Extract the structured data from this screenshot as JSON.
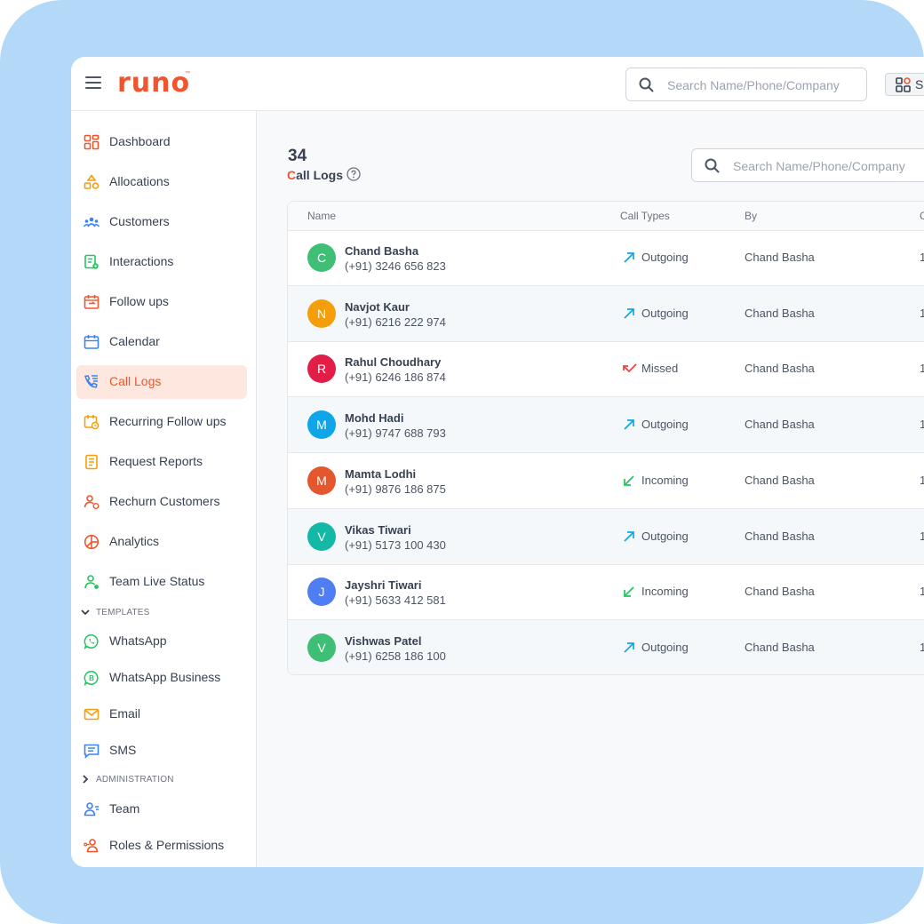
{
  "app": {
    "logo": "runo",
    "logo_tm": "™"
  },
  "header": {
    "search_placeholder": "Search Name/Phone/Company",
    "switch_label": "S"
  },
  "sidebar": {
    "items": [
      {
        "label": "Dashboard",
        "icon": "dashboard-icon"
      },
      {
        "label": "Allocations",
        "icon": "allocations-icon"
      },
      {
        "label": "Customers",
        "icon": "customers-icon"
      },
      {
        "label": "Interactions",
        "icon": "interactions-icon"
      },
      {
        "label": "Follow ups",
        "icon": "follow-ups-icon"
      },
      {
        "label": "Calendar",
        "icon": "calendar-icon"
      },
      {
        "label": "Call Logs",
        "icon": "call-logs-icon",
        "active": true
      },
      {
        "label": "Recurring Follow ups",
        "icon": "recurring-icon"
      },
      {
        "label": "Request Reports",
        "icon": "reports-icon"
      },
      {
        "label": "Rechurn Customers",
        "icon": "rechurn-icon"
      },
      {
        "label": "Analytics",
        "icon": "analytics-icon"
      },
      {
        "label": "Team Live Status",
        "icon": "team-status-icon"
      }
    ],
    "templates_label": "TEMPLATES",
    "templates": [
      {
        "label": "WhatsApp",
        "icon": "whatsapp-icon"
      },
      {
        "label": "WhatsApp Business",
        "icon": "whatsapp-business-icon"
      },
      {
        "label": "Email",
        "icon": "email-icon"
      },
      {
        "label": "SMS",
        "icon": "sms-icon"
      }
    ],
    "administration_label": "ADMINISTRATION",
    "administration": [
      {
        "label": "Team",
        "icon": "team-icon"
      },
      {
        "label": "Roles & Permissions",
        "icon": "roles-icon"
      }
    ]
  },
  "main": {
    "count": "34",
    "title_first": "C",
    "title_rest": "all Logs",
    "search_placeholder": "Search Name/Phone/Company",
    "columns": [
      "Name",
      "Call Types",
      "By",
      "C"
    ],
    "rows": [
      {
        "initial": "C",
        "name": "Chand Basha",
        "phone": "(+91) 3246 656 823",
        "type": "Outgoing",
        "by": "Chand Basha",
        "extra": "1",
        "avatar_color": "#3fbf75"
      },
      {
        "initial": "N",
        "name": "Navjot Kaur",
        "phone": "(+91) 6216 222 974",
        "type": "Outgoing",
        "by": "Chand Basha",
        "extra": "1",
        "avatar_color": "#f59e0b"
      },
      {
        "initial": "R",
        "name": "Rahul Choudhary",
        "phone": "(+91) 6246 186 874",
        "type": "Missed",
        "by": "Chand Basha",
        "extra": "1",
        "avatar_color": "#e11d48"
      },
      {
        "initial": "M",
        "name": "Mohd Hadi",
        "phone": "(+91) 9747 688 793",
        "type": "Outgoing",
        "by": "Chand Basha",
        "extra": "1",
        "avatar_color": "#0ea5e9"
      },
      {
        "initial": "M",
        "name": "Mamta Lodhi",
        "phone": "(+91) 9876 186 875",
        "type": "Incoming",
        "by": "Chand Basha",
        "extra": "1",
        "avatar_color": "#e4572e"
      },
      {
        "initial": "V",
        "name": "Vikas Tiwari",
        "phone": "(+91) 5173 100 430",
        "type": "Outgoing",
        "by": "Chand Basha",
        "extra": "1",
        "avatar_color": "#14b8a6"
      },
      {
        "initial": "J",
        "name": "Jayshri Tiwari",
        "phone": "(+91) 5633 412 581",
        "type": "Incoming",
        "by": "Chand Basha",
        "extra": "1",
        "avatar_color": "#4f7ef2"
      },
      {
        "initial": "V",
        "name": "Vishwas Patel",
        "phone": "(+91) 6258 186 100",
        "type": "Outgoing",
        "by": "Chand Basha",
        "extra": "1",
        "avatar_color": "#3fbf75"
      }
    ]
  },
  "colors": {
    "brand": "#f0552e",
    "outgoing": "#0ea5e9",
    "incoming": "#22c55e",
    "missed": "#ef4444",
    "frame": "#b3d8f8"
  }
}
